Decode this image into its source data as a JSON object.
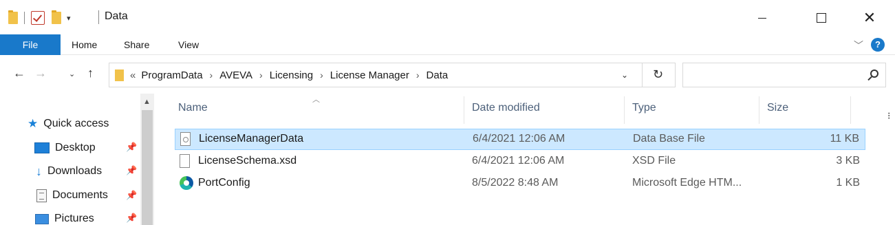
{
  "window": {
    "title": "Data",
    "minimize_icon": "minimize-icon",
    "maximize_icon": "maximize-icon",
    "close_glyph": "✕"
  },
  "ribbon": {
    "tabs": [
      "File",
      "Home",
      "Share",
      "View"
    ],
    "help_glyph": "?"
  },
  "address": {
    "crumbs": [
      "ProgramData",
      "AVEVA",
      "Licensing",
      "License Manager",
      "Data"
    ],
    "ellipsis": "«",
    "separator": "›",
    "search_placeholder": ""
  },
  "nav": {
    "items": [
      {
        "label": "Quick access",
        "icon": "star-icon",
        "pinned": false
      },
      {
        "label": "Desktop",
        "icon": "desktop-icon",
        "pinned": true
      },
      {
        "label": "Downloads",
        "icon": "downloads-icon",
        "pinned": true
      },
      {
        "label": "Documents",
        "icon": "documents-icon",
        "pinned": true
      },
      {
        "label": "Pictures",
        "icon": "pictures-icon",
        "pinned": true
      }
    ]
  },
  "files": {
    "columns": [
      "Name",
      "Date modified",
      "Type",
      "Size"
    ],
    "rows": [
      {
        "name": "LicenseManagerData",
        "date": "6/4/2021 12:06 AM",
        "type": "Data Base File",
        "size": "11 KB",
        "icon": "database-file-icon",
        "selected": true
      },
      {
        "name": "LicenseSchema.xsd",
        "date": "6/4/2021 12:06 AM",
        "type": "XSD File",
        "size": "3 KB",
        "icon": "xsd-file-icon",
        "selected": false
      },
      {
        "name": "PortConfig",
        "date": "8/5/2022 8:48 AM",
        "type": "Microsoft Edge HTM...",
        "size": "1 KB",
        "icon": "edge-icon",
        "selected": false
      }
    ]
  },
  "colors": {
    "accent": "#1979ca",
    "selection": "#cce8ff",
    "selection_border": "#99d1ff",
    "column_header": "#4c607a"
  }
}
